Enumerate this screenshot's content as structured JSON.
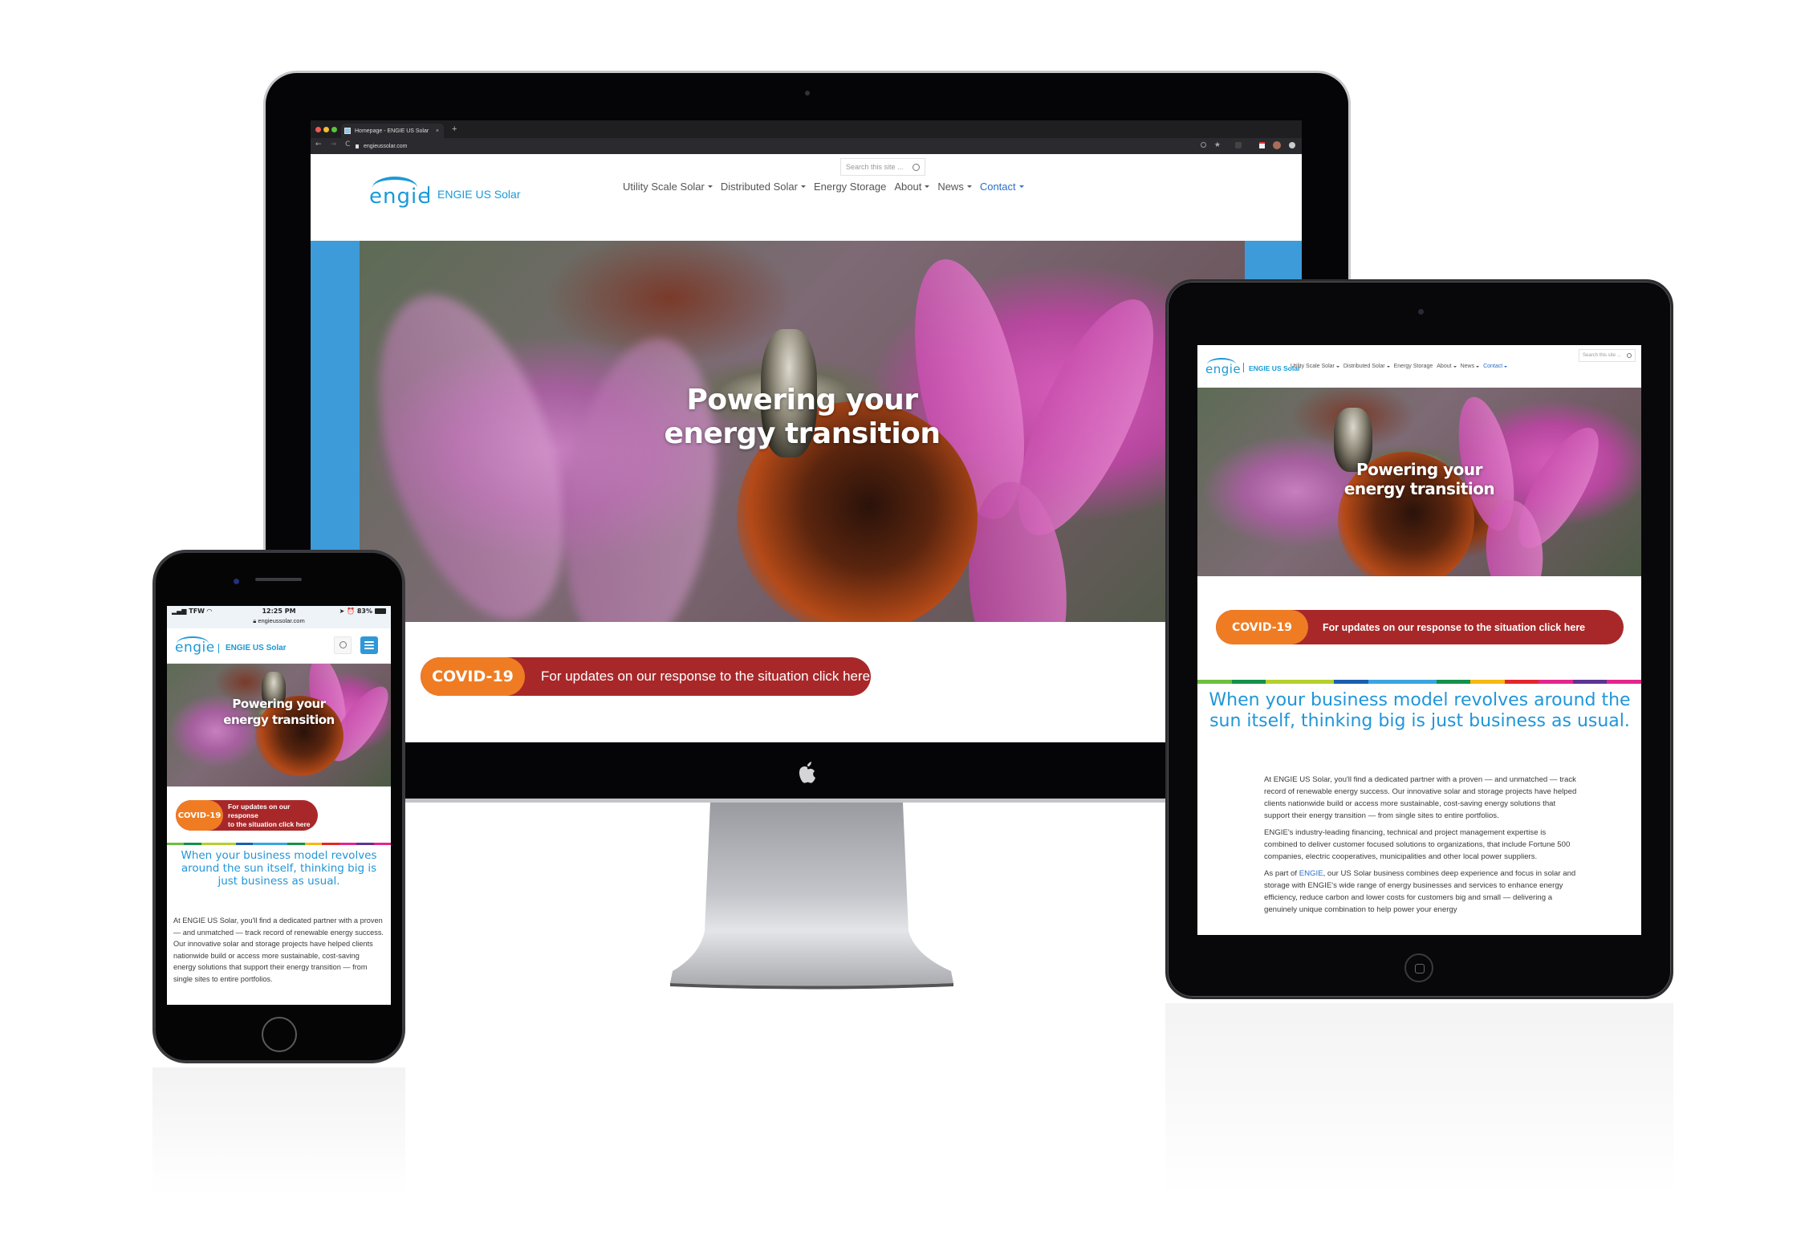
{
  "site": {
    "brand_logo": "ENGIE",
    "site_name": "ENGIE US Solar",
    "search_placeholder": "Search this site ...",
    "nav": [
      {
        "label": "Utility Scale Solar",
        "dropdown": true
      },
      {
        "label": "Distributed Solar",
        "dropdown": true
      },
      {
        "label": "Energy Storage",
        "dropdown": false
      },
      {
        "label": "About",
        "dropdown": true
      },
      {
        "label": "News",
        "dropdown": true
      },
      {
        "label": "Contact",
        "dropdown": true
      }
    ],
    "hero_title_line1": "Powering your",
    "hero_title_line2": "energy transition",
    "covid_tag": "COVID-19",
    "covid_message": "For updates on our response to the situation click here",
    "covid_message_mobile_line1": "For updates on our response",
    "covid_message_mobile_line2": "to the situation click here",
    "headline": "When your business model revolves around the sun itself, thinking big is just business as usual.",
    "paragraphs": [
      "At ENGIE US Solar, you'll find a dedicated partner with a proven — and unmatched — track record of renewable energy success. Our innovative solar and storage projects have helped clients nationwide build or access more sustainable, cost-saving energy solutions that support their energy transition — from single sites to entire portfolios.",
      "ENGIE's industry-leading financing, technical and project management expertise is combined to deliver customer focused solutions to organizations, that include Fortune 500 companies, electric cooperatives, municipalities and other local power suppliers."
    ],
    "paragraph3_prefix": "As part of ",
    "paragraph3_link": "ENGIE",
    "paragraph3_suffix": ", our US Solar business combines deep experience and focus in solar and storage with ENGIE's wide range of energy businesses and services to enhance energy efficiency, reduce carbon and lower costs for customers big and small — delivering a genuinely unique combination to help power your energy",
    "stripe_colors": [
      "#6cbf3f",
      "#14904a",
      "#b6cf2e",
      "#b6cf2e",
      "#1a5fae",
      "#3aa5e0",
      "#3aa5e0",
      "#14904a",
      "#f6b812",
      "#e3262d",
      "#e3268d",
      "#5d3495",
      "#e3268d"
    ],
    "colors": {
      "brand_blue": "#1a9ad6",
      "covid_orange": "#ef7c23",
      "covid_red": "#a8282a",
      "link_blue": "#2a6fc9",
      "hero_side_blue": "#3d9bd9"
    }
  },
  "browser": {
    "tab_title": "Homepage - ENGIE US Solar",
    "tab_close": "×",
    "new_tab": "+",
    "url": "engieussolar.com",
    "back_icon": "←",
    "forward_icon": "→",
    "reload_icon": "C"
  },
  "phone": {
    "carrier": "TFW",
    "time": "12:25 PM",
    "battery": "83%",
    "url": "engieussolar.com"
  }
}
